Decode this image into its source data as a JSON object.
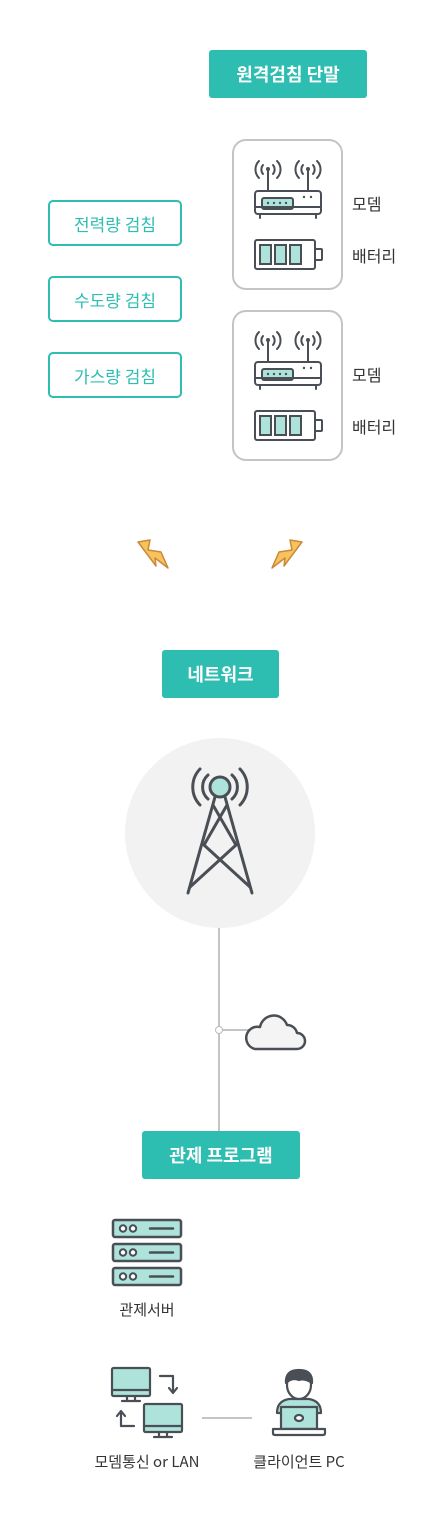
{
  "terminal": {
    "title": "원격검침 단말",
    "meters": [
      "전력량 검침",
      "수도량 검침",
      "가스량 검침"
    ],
    "devices": [
      {
        "modem_label": "모뎀",
        "battery_label": "배터리"
      },
      {
        "modem_label": "모뎀",
        "battery_label": "배터리"
      }
    ]
  },
  "network": {
    "title": "네트워크"
  },
  "control": {
    "title": "관제 프로그램",
    "server_label": "관제서버",
    "modem_lan_label": "모뎀통신 or LAN",
    "client_label": "클라이언트 PC"
  },
  "colors": {
    "accent": "#2dbdb1",
    "icon_fill": "#aee3dc",
    "stroke": "#4a4f55",
    "bolt": "#f7c35c"
  },
  "icons": [
    "antenna-icon",
    "modem-icon",
    "battery-icon",
    "lightning-icon",
    "tower-icon",
    "cloud-icon",
    "server-icon",
    "monitor-icon",
    "person-laptop-icon"
  ]
}
